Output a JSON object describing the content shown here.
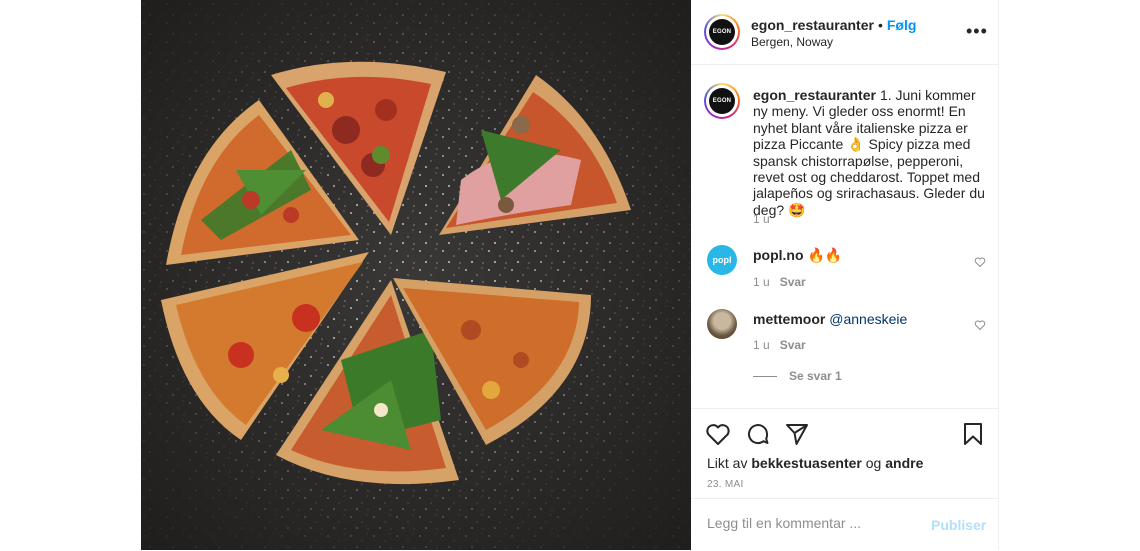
{
  "post": {
    "username": "egon_restauranter",
    "dot": "•",
    "follow_label": "Følg",
    "location": "Bergen, Noway",
    "logo_text": "EGON",
    "more_icon": "more-horizontal-icon"
  },
  "caption": {
    "username": "egon_restauranter",
    "text": "1. Juni kommer ny meny. Vi gleder oss enormt! En nyhet blant våre italienske pizza er pizza Piccante 👌 Spicy pizza med spansk chistorrapølse, pepperoni, revet ost og cheddarost. Toppet med jalapeños og srirachasaus. Gleder du deg? 🤩",
    "time": "1 u"
  },
  "comments": [
    {
      "username": "popl.no",
      "avatar_text": "popl",
      "text": "🔥🔥",
      "time": "1 u",
      "reply_label": "Svar"
    },
    {
      "username": "mettemoor",
      "mention": "@anneskeie",
      "text": "",
      "time": "1 u",
      "reply_label": "Svar"
    }
  ],
  "see_replies": "Se svar 1",
  "likes": {
    "prefix": "Likt av",
    "user": "bekkestuasenter",
    "joiner": "og",
    "others": "andre"
  },
  "date": "23. MAI",
  "comment_box": {
    "placeholder": "Legg til en kommentar ...",
    "publish_label": "Publiser"
  },
  "colors": {
    "accent": "#0095f6",
    "publish_disabled": "#b2dffc",
    "muted": "#8e8e8e",
    "text": "#262626"
  }
}
